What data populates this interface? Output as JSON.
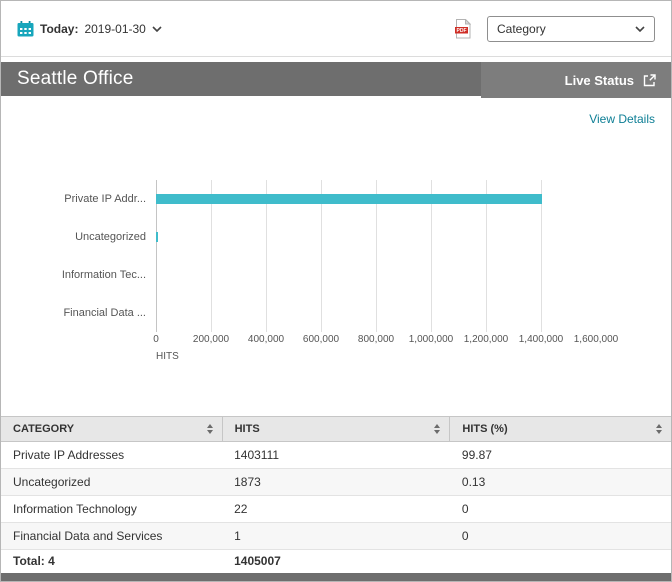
{
  "topbar": {
    "today_label": "Today:",
    "date_value": "2019-01-30",
    "category_select": {
      "value": "Category"
    }
  },
  "header": {
    "title": "Seattle Office",
    "live_status": "Live Status"
  },
  "panel": {
    "view_details": "View Details"
  },
  "chart_data": {
    "type": "bar",
    "orientation": "horizontal",
    "categories": [
      "Private IP Addr...",
      "Uncategorized",
      "Information Tec...",
      "Financial Data ..."
    ],
    "values": [
      1403111,
      1873,
      22,
      1
    ],
    "xlabel": "HITS",
    "xlim": [
      0,
      1600000
    ],
    "xticks": [
      0,
      200000,
      400000,
      600000,
      800000,
      1000000,
      1200000,
      1400000,
      1600000
    ],
    "xtick_labels": [
      "0",
      "200,000",
      "400,000",
      "600,000",
      "800,000",
      "1,000,000",
      "1,200,000",
      "1,400,000",
      "1,600,000"
    ],
    "bar_color": "#3fbccb",
    "grid": true,
    "legend": "none"
  },
  "table": {
    "columns": [
      "CATEGORY",
      "HITS",
      "HITS (%)"
    ],
    "rows": [
      [
        "Private IP Addresses",
        "1403111",
        "99.87"
      ],
      [
        "Uncategorized",
        "1873",
        "0.13"
      ],
      [
        "Information Technology",
        "22",
        "0"
      ],
      [
        "Financial Data and Services",
        "1",
        "0"
      ]
    ],
    "total_label": "Total: 4",
    "total_hits": "1405007"
  },
  "icons": {
    "calendar": "calendar-icon",
    "chevron_down": "chevron-down-icon",
    "pdf": "pdf-export-icon",
    "external_link": "external-link-icon",
    "sort": "sort-icon"
  },
  "colors": {
    "accent_teal": "#17a6bc",
    "bar_teal": "#3fbccb",
    "link_teal": "#0d7e95",
    "header_gray": "#6e6e6e",
    "pdf_red": "#cf2e26"
  }
}
